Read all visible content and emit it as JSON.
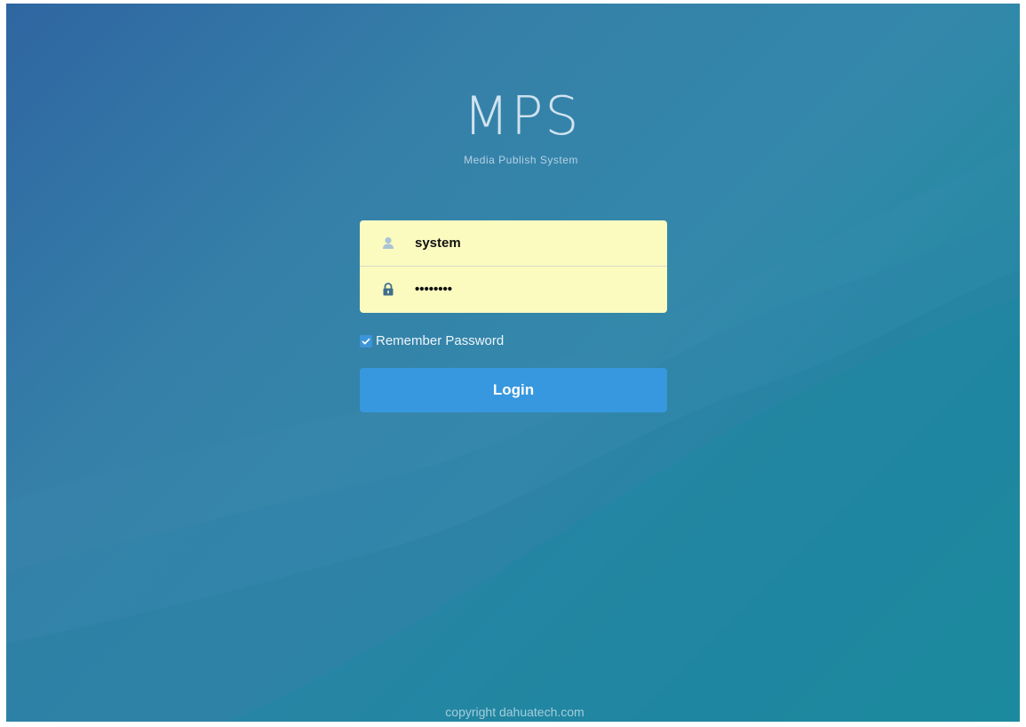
{
  "logo": {
    "title": "MPS",
    "subtitle": "Media  Publish  System"
  },
  "form": {
    "username": {
      "icon": "user-icon",
      "value": "system"
    },
    "password": {
      "icon": "lock-icon",
      "masked_value": "••••••••"
    },
    "remember": {
      "label": "Remember Password",
      "checked": true
    },
    "login_label": "Login"
  },
  "footer": {
    "copyright": "copyright dahuatech.com"
  },
  "colors": {
    "form_background": "#fbfbc0",
    "button": "#3798df",
    "checkbox": "#3d95d8"
  }
}
